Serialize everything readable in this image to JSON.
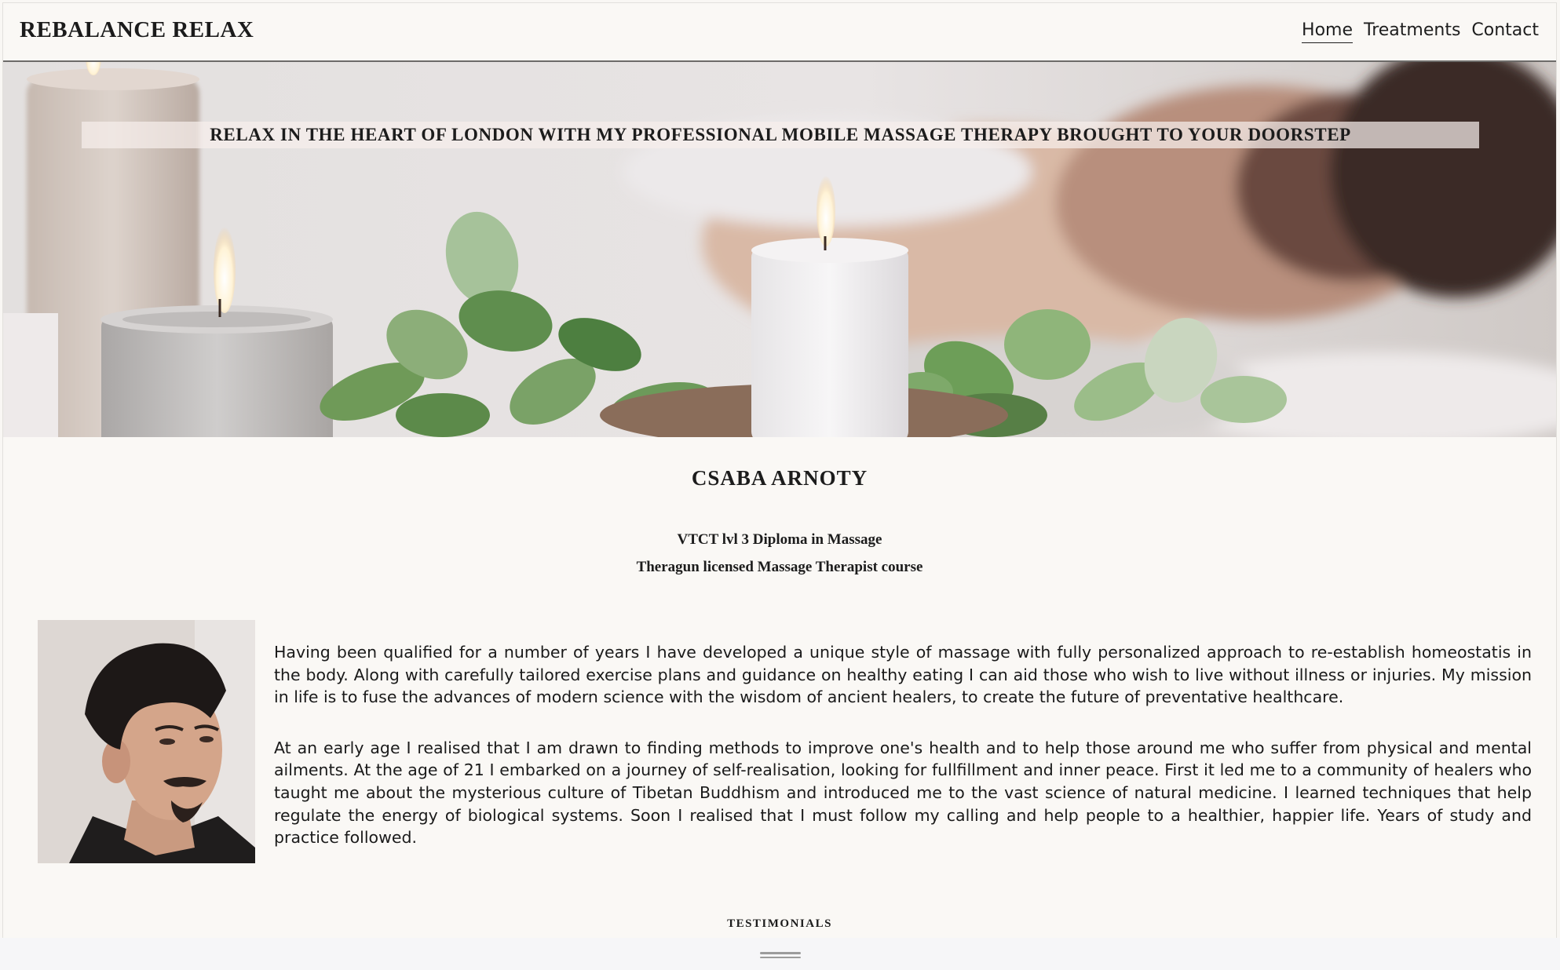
{
  "header": {
    "brand": "REBALANCE RELAX",
    "nav": [
      {
        "label": "Home",
        "active": true
      },
      {
        "label": "Treatments",
        "active": false
      },
      {
        "label": "Contact",
        "active": false
      }
    ]
  },
  "hero": {
    "tagline": "RELAX IN THE HEART OF LONDON WITH MY PROFESSIONAL MOBILE MASSAGE THERAPY BROUGHT TO YOUR DOORSTEP"
  },
  "profile": {
    "name": "CSABA ARNOTY",
    "qualifications": [
      "VTCT lvl 3 Diploma in Massage",
      "Theragun licensed Massage Therapist course"
    ],
    "bio": [
      "Having been qualified for a number of years I have developed a unique style of massage with fully personalized approach to re-establish homeostatis in the body. Along with carefully tailored exercise plans and guidance on healthy eating I can aid those who wish to live without illness or injuries. My mission in life is to fuse the advances of modern science with the wisdom of ancient healers, to create the future of preventative healthcare.",
      "At an early age I realised that I am drawn to finding methods to improve one's health and to help those around me who suffer from physical and mental ailments. At the age of 21 I embarked on a journey of self-realisation, looking for fullfillment and inner peace. First it led me to a community of healers who taught me about the mysterious culture of Tibetan Buddhism and introduced me to the vast science of natural medicine. I learned techniques that help regulate the energy of biological systems. Soon I realised that I must follow my calling and help people to a healthier, happier life. Years of study and practice followed."
    ]
  },
  "testimonials": {
    "heading": "TESTIMONIALS"
  },
  "colors": {
    "page_background": "#faf8f5",
    "text": "#1c1c1c",
    "banner_overlay": "#f6eeec"
  }
}
